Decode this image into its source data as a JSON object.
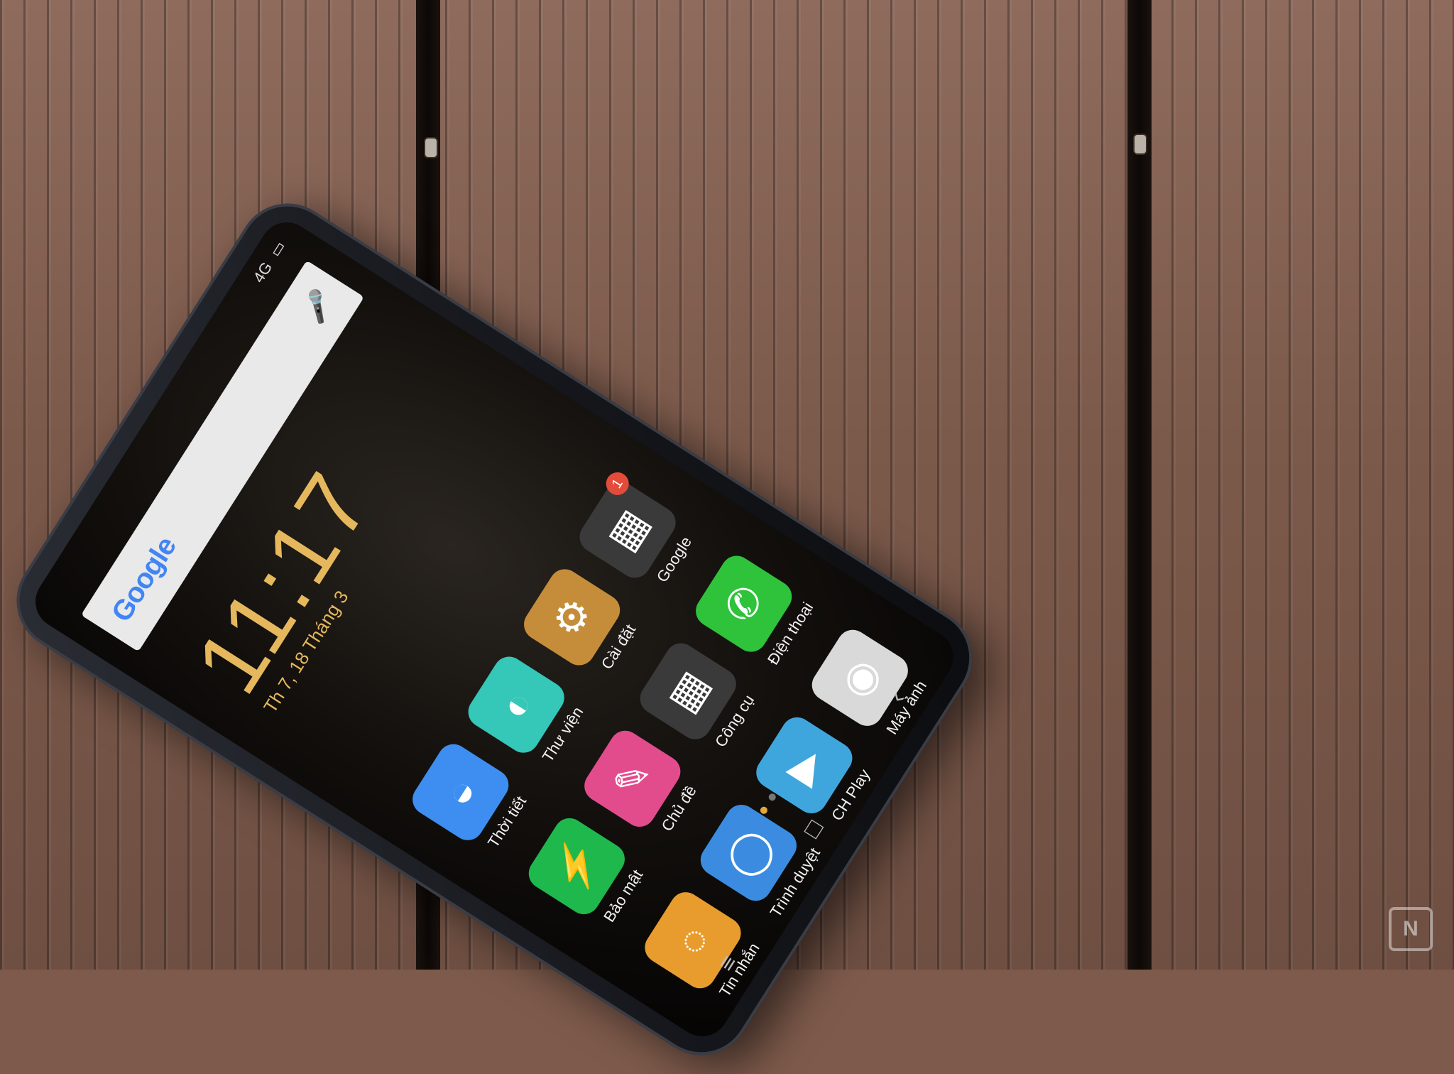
{
  "search": {
    "logo": "Google",
    "mic_icon": "microphone-icon"
  },
  "status": {
    "network": "4G"
  },
  "clock": {
    "time": "11:17",
    "date": "Th 7, 18 Tháng 3"
  },
  "apps": [
    {
      "label": "Thời tiết",
      "icon": "weather-icon",
      "color": "#3d8ef0"
    },
    {
      "label": "Thư viện",
      "icon": "gallery-icon",
      "color": "#35c7b7"
    },
    {
      "label": "Cài đặt",
      "icon": "gear-icon",
      "color": "#c58d3a"
    },
    {
      "label": "Google",
      "icon": "folder-icon",
      "color": "#3a3a3a",
      "badge": "1"
    },
    {
      "label": "Bảo mật",
      "icon": "shield-icon",
      "color": "#1fb84d"
    },
    {
      "label": "Chủ đề",
      "icon": "paint-brush-icon",
      "color": "#e24c8d"
    },
    {
      "label": "Công cụ",
      "icon": "folder-icon",
      "color": "#3a3a3a"
    },
    {
      "label": "Điện thoại",
      "icon": "phone-icon",
      "color": "#2fc23b"
    },
    {
      "label": "Tin nhắn",
      "icon": "message-icon",
      "color": "#e99c2e"
    },
    {
      "label": "Trình duyệt",
      "icon": "browser-icon",
      "color": "#3b8ce0"
    },
    {
      "label": "CH Play",
      "icon": "play-store-icon",
      "color": "#3fa6dd"
    },
    {
      "label": "Máy ảnh",
      "icon": "camera-icon",
      "color": "#d9d9d9"
    }
  ],
  "nav": {
    "menu": "≡",
    "home": "□",
    "back": "‹"
  }
}
